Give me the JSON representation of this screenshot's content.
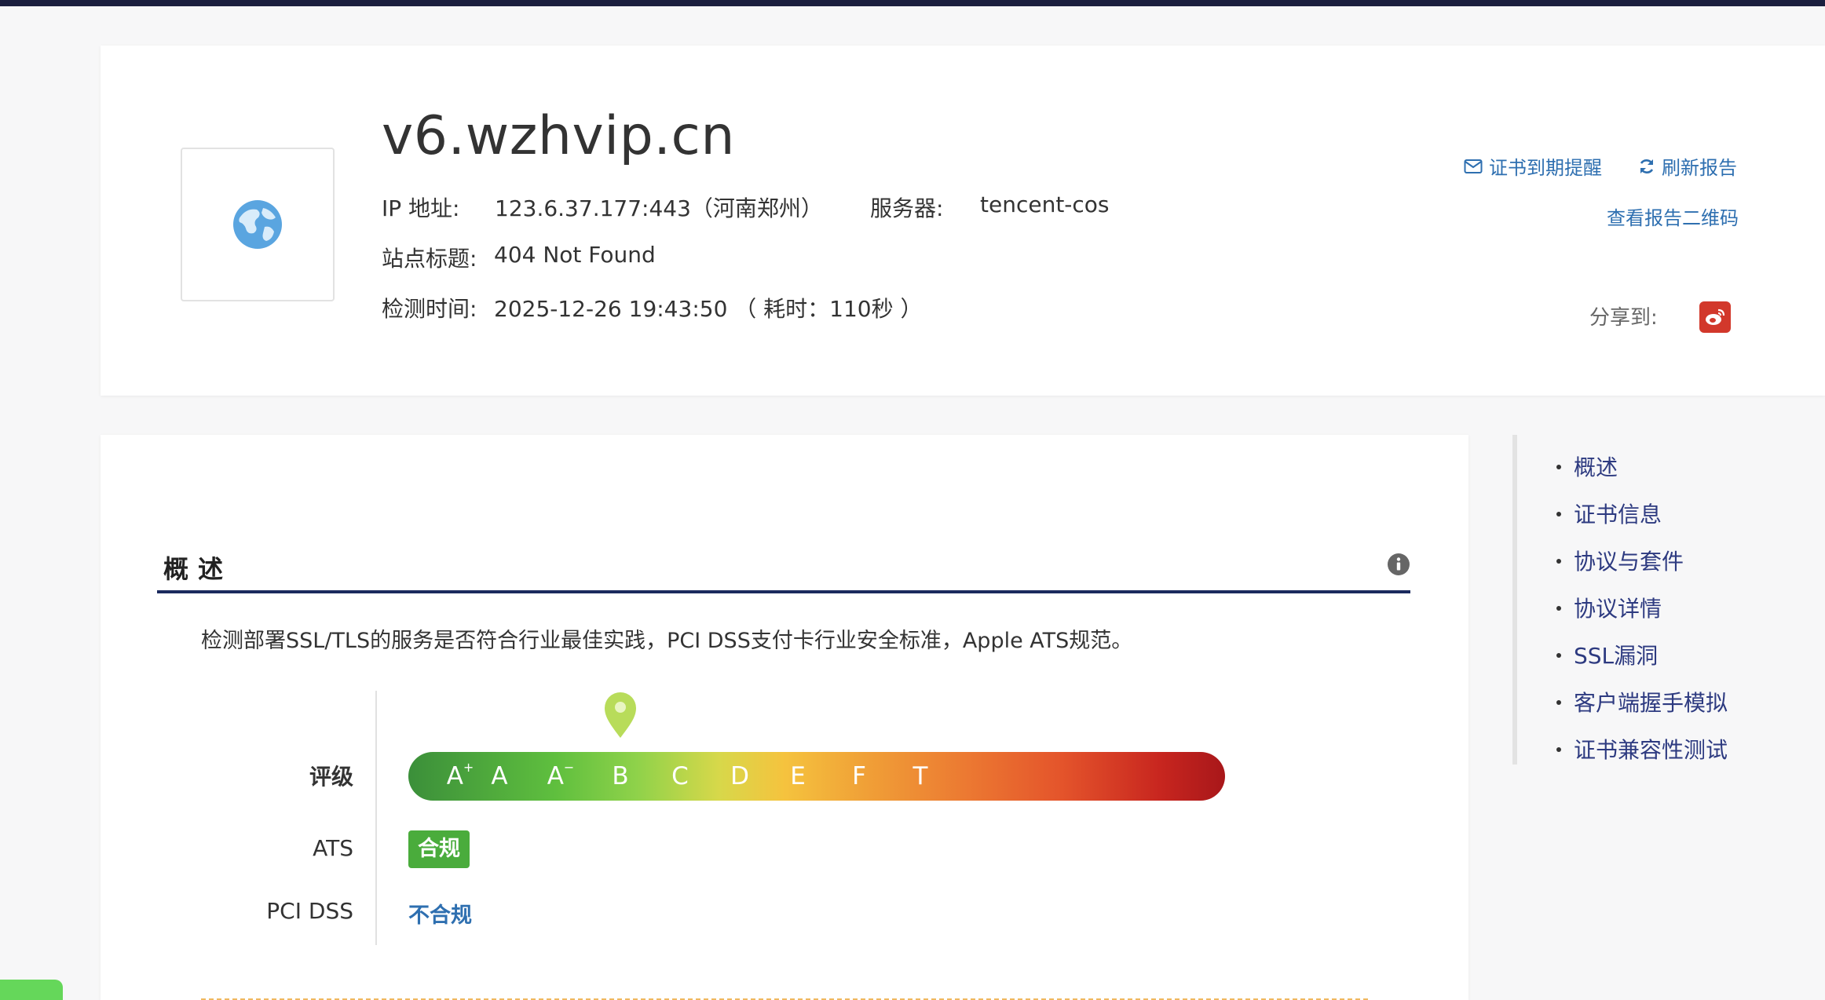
{
  "header": {
    "domain": "v6.wzhvip.cn",
    "ip_label": "IP 地址:",
    "ip_value": "123.6.37.177:443（河南郑州）",
    "server_label": "服务器:",
    "server_value": "tencent-cos",
    "site_title_label": "站点标题:",
    "site_title_value": "404 Not Found",
    "check_time_label": "检测时间:",
    "check_time_value": "2025-12-26 19:43:50 （ 耗时：110秒 ）",
    "actions": {
      "cert_reminder": "证书到期提醒",
      "refresh_report": "刷新报告",
      "view_qrcode": "查看报告二维码"
    },
    "share_label": "分享到:",
    "logo_icon": "globe-icon",
    "share_icon": "weibo-icon"
  },
  "overview": {
    "title": "概述",
    "description": "检测部署SSL/TLS的服务是否符合行业最佳实践，PCI DSS支付卡行业安全标准，Apple ATS规范。",
    "grade_label": "评级",
    "grades": [
      {
        "main": "A",
        "mark": "+"
      },
      {
        "main": "A",
        "mark": ""
      },
      {
        "main": "A",
        "mark": "−"
      },
      {
        "main": "B",
        "mark": ""
      },
      {
        "main": "C",
        "mark": ""
      },
      {
        "main": "D",
        "mark": ""
      },
      {
        "main": "E",
        "mark": ""
      },
      {
        "main": "F",
        "mark": ""
      },
      {
        "main": "T",
        "mark": ""
      }
    ],
    "current_grade_index": 3,
    "ats_label": "ATS",
    "ats_value": "合规",
    "pci_label": "PCI DSS",
    "pci_value": "不合规",
    "colors": {
      "ats_badge": "#4aac3c",
      "pin": "#b8dc5a",
      "link": "#2e6fb0",
      "rule": "#1b2a5e"
    }
  },
  "side_nav": {
    "items": [
      "概述",
      "证书信息",
      "协议与套件",
      "协议详情",
      "SSL漏洞",
      "客户端握手模拟",
      "证书兼容性测试"
    ]
  }
}
